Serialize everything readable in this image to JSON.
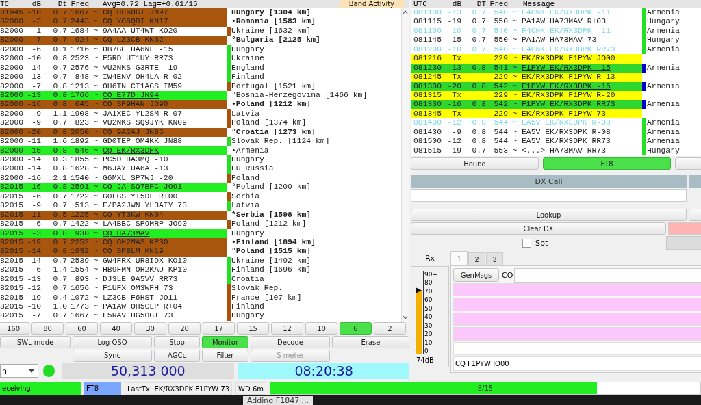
{
  "band_activity": {
    "tab_label": "Band Activity",
    "header": {
      "utc": "TC",
      "db": "dB",
      "dt": "Dt",
      "freq": "Freq",
      "info": "Avg=0.72 Lag=+0.61/15"
    },
    "rows": [
      {
        "time": "81945",
        "db": "-10",
        "dt": "0.7",
        "freq": "1667",
        "sync": "~",
        "message": "CQ HG5OGI JN97",
        "kind": "cq",
        "country": "Hungary [1304 km]"
      },
      {
        "time": "82000",
        "db": "-3",
        "dt": "0.7",
        "freq": "2443",
        "sync": "~",
        "message": "CQ YO5QDI KN17",
        "kind": "cq",
        "country": "•Romania [1583 km]"
      },
      {
        "time": "82000",
        "db": "-1",
        "dt": "0.7",
        "freq": "1684",
        "sync": "~",
        "message": "9A4AA UT4WT KO20",
        "kind": "plain",
        "color": "#a8520c",
        "country": "Ukraine [1632 km]"
      },
      {
        "time": "82000",
        "db": "-7",
        "dt": "0.7",
        "freq": "924",
        "sync": "~",
        "message": "CQ LZ3CB KN32",
        "kind": "cq",
        "country": "°Bulgaria [2125 km]"
      },
      {
        "time": "82000",
        "db": "-6",
        "dt": "0.1",
        "freq": "1716",
        "sync": "~",
        "message": "DB7GE HA6NL -15",
        "kind": "plain",
        "color": "#22e022",
        "country": "Hungary"
      },
      {
        "time": "82000",
        "db": "-10",
        "dt": "0.8",
        "freq": "2523",
        "sync": "~",
        "message": "F5RD UT1UY RR73",
        "kind": "plain",
        "color": "#22e022",
        "country": "Ukraine"
      },
      {
        "time": "82000",
        "db": "-14",
        "dt": "0.7",
        "freq": "2576",
        "sync": "~",
        "message": "VU2NKS G3RTE -19",
        "kind": "plain",
        "color": "#22e022",
        "country": "England"
      },
      {
        "time": "82000",
        "db": "-13",
        "dt": "0.7",
        "freq": "848",
        "sync": "~",
        "message": "IW4ENV OH4LA R-02",
        "kind": "plain",
        "color": "#22e022",
        "country": "Finland"
      },
      {
        "time": "82000",
        "db": "-7",
        "dt": "0.8",
        "freq": "1213",
        "sync": "~",
        "message": "OH6TN CT1AGS IM59",
        "kind": "plain",
        "color": "#a8520c",
        "country": "Portugal [1521 km]"
      },
      {
        "time": "82000",
        "db": "-13",
        "dt": "0.8",
        "freq": "1766",
        "sync": "~",
        "message": "CQ E77D JN94",
        "kind": "new",
        "country": "°Bosnia-Herzegovina [1466 km]"
      },
      {
        "time": "82000",
        "db": "-16",
        "dt": "0.8",
        "freq": "645",
        "sync": "~",
        "message": "CQ SP9HAN JO90",
        "kind": "cq",
        "country": "•Poland [1212 km]"
      },
      {
        "time": "82000",
        "db": "-9",
        "dt": "1.1",
        "freq": "1908",
        "sync": "~",
        "message": "JA1XEC YL2SM R-07",
        "kind": "plain",
        "color": "#a8520c",
        "country": "Latvia"
      },
      {
        "time": "82000",
        "db": "-9",
        "dt": "0.7",
        "freq": "823",
        "sync": "~",
        "message": "VU2NKS SQ9JYK KN09",
        "kind": "plain",
        "color": "#a8520c",
        "country": "Poland [1374 km]"
      },
      {
        "time": "82000",
        "db": "-20",
        "dt": "0.8",
        "freq": "2050",
        "sync": "~",
        "message": "CQ 9A2AJ JN85",
        "kind": "cq",
        "country": "°Croatia [1273 km]"
      },
      {
        "time": "82000",
        "db": "-11",
        "dt": "1.6",
        "freq": "1892",
        "sync": "~",
        "message": "GD0TEP OM4KK JN88",
        "kind": "plain",
        "color": "#22e022",
        "country": "Slovak Rep. [1124 km]"
      },
      {
        "time": "82000",
        "db": "-15",
        "dt": "0.8",
        "freq": "546",
        "sync": "~",
        "message": "CQ EK/RX3DPK",
        "kind": "new",
        "country": "•Armenia"
      },
      {
        "time": "82000",
        "db": "-14",
        "dt": "0.3",
        "freq": "1855",
        "sync": "~",
        "message": "PC5D HA3MQ -10",
        "kind": "plain",
        "color": "#22e022",
        "country": "Hungary"
      },
      {
        "time": "82000",
        "db": "-14",
        "dt": "0.8",
        "freq": "1628",
        "sync": "~",
        "message": "M6JAY UA6A -13",
        "kind": "plain",
        "color": "#22e022",
        "country": "EU Russia"
      },
      {
        "time": "82000",
        "db": "-16",
        "dt": "2.1",
        "freq": "1540",
        "sync": "~",
        "message": "G6MXL SP7WJ -20",
        "kind": "plain",
        "color": "#a8520c",
        "country": "Poland"
      },
      {
        "time": "82015",
        "db": "-16",
        "dt": "0.8",
        "freq": "2591",
        "sync": "~",
        "message": "CQ JA SQ7BFC JO91",
        "kind": "new",
        "country": "°Poland [1200 km]"
      },
      {
        "time": "82015",
        "db": "-6",
        "dt": "0.7",
        "freq": "1722",
        "sync": "~",
        "message": "G0LGS YT5DL R+00",
        "kind": "plain",
        "color": "#a8520c",
        "country": "Serbia"
      },
      {
        "time": "82015",
        "db": "-9",
        "dt": "0.7",
        "freq": "513",
        "sync": "~",
        "message": "F/PA2JWN YL3AIY 73",
        "kind": "plain",
        "color": "#22e022",
        "country": "Latvia"
      },
      {
        "time": "82015",
        "db": "-11",
        "dt": "0.5",
        "freq": "1225",
        "sync": "~",
        "message": "CQ YT3KW KN04",
        "kind": "cq",
        "country": "*Serbia [1598 km]"
      },
      {
        "time": "82015",
        "db": "-6",
        "dt": "0.7",
        "freq": "1422",
        "sync": "~",
        "message": "LA4BBC SP9MRP JO90",
        "kind": "plain",
        "color": "#a8520c",
        "country": "Poland [1212 km]"
      },
      {
        "time": "82015",
        "db": "-3",
        "dt": "0.8",
        "freq": "930",
        "sync": "~",
        "message": "CQ HA73MAV",
        "kind": "new",
        "country": "Hungary"
      },
      {
        "time": "82015",
        "db": "-19",
        "dt": "0.7",
        "freq": "2252",
        "sync": "~",
        "message": "CQ OH2MAS KP30",
        "kind": "cq",
        "country": "•Finland [1894 km]"
      },
      {
        "time": "82015",
        "db": "-14",
        "dt": "0.8",
        "freq": "1932",
        "sync": "~",
        "message": "CQ SP8LM KN19",
        "kind": "cq",
        "country": "°Poland [1515 km]"
      },
      {
        "time": "82015",
        "db": "-14",
        "dt": "0.7",
        "freq": "2539",
        "sync": "~",
        "message": "GW4FRX UR8IDX KO10",
        "kind": "plain",
        "color": "#22e022",
        "country": "Ukraine [1492 km]"
      },
      {
        "time": "82015",
        "db": "-6",
        "dt": "1.4",
        "freq": "1554",
        "sync": "~",
        "message": "HB9FMN OH2KAD KP10",
        "kind": "plain",
        "color": "#22e022",
        "country": "Finland [1696 km]"
      },
      {
        "time": "82015",
        "db": "-13",
        "dt": "0.7",
        "freq": "893",
        "sync": "~",
        "message": "DJ3LE 9A5VV RR73",
        "kind": "plain",
        "color": "#22e022",
        "country": "Croatia"
      },
      {
        "time": "82015",
        "db": "-12",
        "dt": "0.7",
        "freq": "1656",
        "sync": "~",
        "message": "F1UFX OM3WFH 73",
        "kind": "plain",
        "color": "#a8520c",
        "country": "Slovak Rep."
      },
      {
        "time": "82015",
        "db": "-19",
        "dt": "0.4",
        "freq": "1072",
        "sync": "~",
        "message": "LZ3CB F6HST JO11",
        "kind": "plain",
        "color": "#a8520c",
        "country": "France [107 km]"
      },
      {
        "time": "82015",
        "db": "-10",
        "dt": "1.0",
        "freq": "1773",
        "sync": "~",
        "message": "PA1AW OH5CLP R+04",
        "kind": "plain",
        "color": "#a8520c",
        "country": "Finland"
      },
      {
        "time": "82015",
        "db": "-7",
        "dt": "0.7",
        "freq": "1667",
        "sync": "~",
        "message": "F5RAV HG5OGI 73",
        "kind": "plain",
        "color": "#a8520c",
        "country": "Hungary"
      }
    ]
  },
  "rx_frequency": {
    "header": {
      "utc": "UTC",
      "db": "dB",
      "dt": "DT",
      "freq": "Freq",
      "info": "Message"
    },
    "rows": [
      {
        "time": "081100",
        "db": "-13",
        "dt": "0.7",
        "freq": "540",
        "sync": "~",
        "message": "F4CNK EK/RX3DPK -11",
        "kind": "echo",
        "color": "#22e022",
        "country": "Armenia"
      },
      {
        "time": "081115",
        "db": "-19",
        "dt": "0.7",
        "freq": "550",
        "sync": "~",
        "message": "PA1AW HA73MAV R+03",
        "kind": "plain",
        "color": "#22e022",
        "country": "Hungary"
      },
      {
        "time": "081130",
        "db": "-10",
        "dt": "0.7",
        "freq": "540",
        "sync": "~",
        "message": "F4CNK EK/RX3DPK -11",
        "kind": "echo",
        "color": "#22e022",
        "country": "Armenia"
      },
      {
        "time": "081145",
        "db": "-15",
        "dt": "0.7",
        "freq": "550",
        "sync": "~",
        "message": "PA1AW HA73MAV 73",
        "kind": "plain",
        "color": "#22e022",
        "country": "Hungary"
      },
      {
        "time": "081200",
        "db": "-10",
        "dt": "0.7",
        "freq": "540",
        "sync": "~",
        "message": "F4CNK EK/RX3DPK RR73",
        "kind": "echo",
        "color": "#22e022",
        "country": "Armenia"
      },
      {
        "time": "081216",
        "db": "Tx",
        "freq": "229",
        "sync": "~",
        "message": "EK/RX3DPK F1PYW JO00",
        "kind": "tx"
      },
      {
        "time": "081230",
        "db": "-13",
        "dt": "0.8",
        "freq": "541",
        "sync": "~",
        "message": "F1PYW EK/RX3DPK -15",
        "kind": "new",
        "color": "#0000cc",
        "country": "Armenia"
      },
      {
        "time": "081245",
        "db": "Tx",
        "freq": "229",
        "sync": "~",
        "message": "EK/RX3DPK F1PYW R-13",
        "kind": "tx"
      },
      {
        "time": "081300",
        "db": "-20",
        "dt": "0.8",
        "freq": "542",
        "sync": "~",
        "message": "F1PYW EK/RX3DPK -15",
        "kind": "new",
        "color": "#0000cc",
        "country": "Armenia"
      },
      {
        "time": "081315",
        "db": "Tx",
        "freq": "229",
        "sync": "~",
        "message": "EK/RX3DPK F1PYW R-20",
        "kind": "tx"
      },
      {
        "time": "081330",
        "db": "-16",
        "dt": "0.8",
        "freq": "542",
        "sync": "~",
        "message": "F1PYW EK/RX3DPK RR73",
        "kind": "new",
        "color": "#0000cc",
        "country": "Armenia"
      },
      {
        "time": "081345",
        "db": "Tx",
        "freq": "229",
        "sync": "~",
        "message": "EK/RX3DPK F1PYW 73",
        "kind": "tx"
      },
      {
        "time": "081400",
        "db": "-12",
        "dt": "0.8",
        "freq": "544",
        "sync": "~",
        "message": "EA5V EK/RX3DPK R-08",
        "kind": "echo",
        "color": "#22e022",
        "country": "Armenia"
      },
      {
        "time": "081430",
        "db": "-9",
        "dt": "0.8",
        "freq": "544",
        "sync": "~",
        "message": "EA5V EK/RX3DPK R-08",
        "kind": "plain",
        "color": "#22e022",
        "country": "Armenia"
      },
      {
        "time": "081500",
        "db": "-12",
        "dt": "0.8",
        "freq": "544",
        "sync": "~",
        "message": "EA5V EK/RX3DPK RR73",
        "kind": "plain",
        "color": "#22e022",
        "country": "Armenia"
      },
      {
        "time": "081515",
        "db": "-19",
        "dt": "0.7",
        "freq": "553",
        "sync": "~",
        "message": "<...> HA73MAV RR73",
        "kind": "plain",
        "color": "#22e022",
        "country": "Hungary"
      }
    ]
  },
  "mode_buttons": [
    {
      "label": "Hound",
      "selected": false
    },
    {
      "label": "FT8",
      "selected": true
    }
  ],
  "dx_call": {
    "label": "DX Call"
  },
  "lookup": "Lookup",
  "clear_dx": "Clear DX",
  "spt": {
    "label": "Spt",
    "checked": false
  },
  "tx_panel": {
    "rx_label": "Rx",
    "tabs": [
      {
        "label": "1",
        "selected": true
      },
      {
        "label": "2",
        "selected": false
      },
      {
        "label": "3",
        "selected": false
      }
    ],
    "meter": {
      "level": 0.8,
      "ticks": [
        "90+",
        "80",
        "70",
        "60",
        "50",
        "40",
        "30",
        "20",
        "10",
        "0"
      ],
      "reading": "74dB"
    },
    "genmsgs": "GenMsgs",
    "cq_label": "CQ",
    "free_text": "CQ F1PYW JO00"
  },
  "bands": [
    {
      "label": "160",
      "selected": false
    },
    {
      "label": "80",
      "selected": false
    },
    {
      "label": "60",
      "selected": false
    },
    {
      "label": "40",
      "selected": false
    },
    {
      "label": "30",
      "selected": false
    },
    {
      "label": "20",
      "selected": false
    },
    {
      "label": "17",
      "selected": false
    },
    {
      "label": "15",
      "selected": false
    },
    {
      "label": "12",
      "selected": false
    },
    {
      "label": "10",
      "selected": false
    },
    {
      "label": "6",
      "selected": true
    },
    {
      "label": "2",
      "selected": false
    }
  ],
  "controls": [
    {
      "label": "SWL mode",
      "on": false,
      "disabled": false
    },
    {
      "label": "Log QSO",
      "on": false,
      "disabled": false
    },
    {
      "label": "Stop",
      "on": false,
      "disabled": false
    },
    {
      "label": "Monitor",
      "on": true,
      "disabled": false
    },
    {
      "label": "Decode",
      "on": false,
      "disabled": false
    },
    {
      "label": "Erase",
      "on": false,
      "disabled": false
    }
  ],
  "controls_2": [
    {
      "label": "Sync",
      "on": false,
      "disabled": false
    },
    {
      "label": "AGCc",
      "on": false,
      "disabled": false
    },
    {
      "label": "Filter",
      "on": false,
      "disabled": false
    },
    {
      "label": "S meter",
      "on": false,
      "disabled": true
    }
  ],
  "dropdown": {
    "value": "n"
  },
  "frequency": "50,313 000",
  "clock": "08:20:38",
  "status_bar": {
    "state": "eceiving",
    "mode": "FT8",
    "last_tx": "LastTx: EK/RX3DPK F1PYW 73",
    "wd": "WD 6m",
    "progress": {
      "level": 0.76,
      "text": "8/15"
    }
  },
  "taskbar": {
    "notice": "Adding F1847 ..."
  }
}
